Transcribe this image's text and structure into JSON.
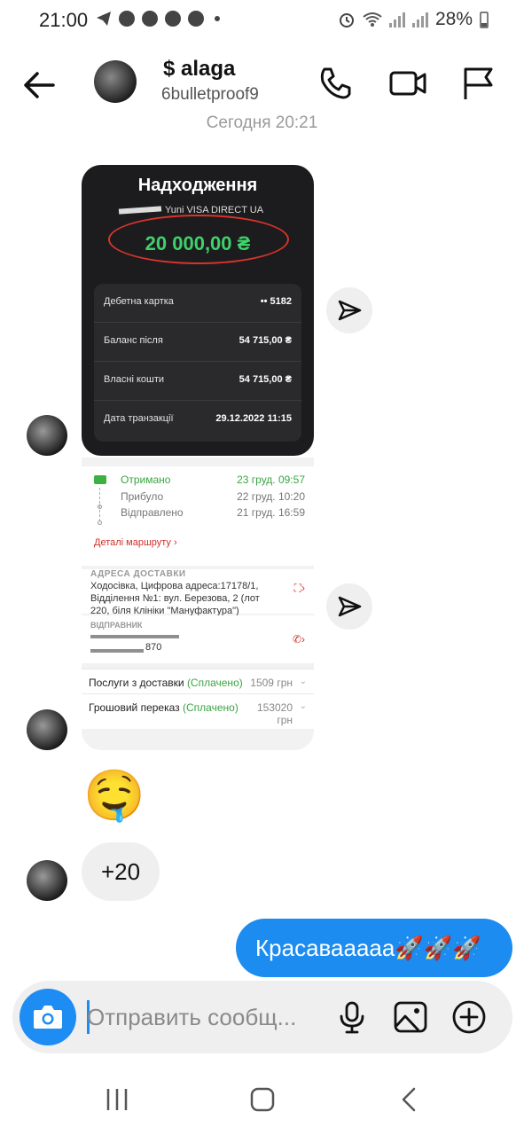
{
  "status_bar": {
    "time": "21:00",
    "battery": "28%"
  },
  "header": {
    "display_name": "$ alaga",
    "username": "6bulletproof9"
  },
  "date_separator": "Сегодня 20:21",
  "receipt_card": {
    "title": "Надходження",
    "subtitle": "Yuni VISA DIRECT UA",
    "amount": "20 000,00 ₴",
    "rows": [
      {
        "label": "Дебетна картка",
        "value": "•• 5182"
      },
      {
        "label": "Баланс після",
        "value": "54 715,00 ₴"
      },
      {
        "label": "Власні кошти",
        "value": "54 715,00 ₴"
      },
      {
        "label": "Дата транзакції",
        "value": "29.12.2022 11:15"
      }
    ]
  },
  "delivery_card": {
    "tracking": [
      {
        "label": "Отримано",
        "value": "23 груд. 09:57"
      },
      {
        "label": "Прибуло",
        "value": "22 груд. 10:20"
      },
      {
        "label": "Відправлено",
        "value": "21 груд. 16:59"
      }
    ],
    "route_link": "Деталі маршруту ›",
    "address_header": "АДРЕСА ДОСТАВКИ",
    "address_text": "Ходосівка, Цифрова адреса:17178/1, Відділення №1: вул. Березова, 2 (лот 220, біля Клініки \"Мануфактура\")",
    "sender_header": "ВІДПРАВНИК",
    "sender_phone_tail": "870",
    "fees": [
      {
        "label": "Послуги з доставки",
        "status": "(Сплачено)",
        "value": "1509 грн"
      },
      {
        "label": "Грошовий переказ",
        "status": "(Сплачено)",
        "value": "153020 грн"
      }
    ]
  },
  "messages": {
    "emoji": "🤤",
    "incoming_text": "+20",
    "outgoing_text": "Красавааааа🚀🚀🚀"
  },
  "composer": {
    "placeholder": "Отправить сообщ..."
  },
  "icons": {
    "back": "arrow-left-icon",
    "call": "phone-icon",
    "video": "video-camera-icon",
    "report": "flag-icon",
    "share": "send-icon",
    "camera": "camera-icon",
    "mic": "microphone-icon",
    "gallery": "image-icon",
    "add": "plus-circle-icon"
  },
  "colors": {
    "outgoing_bubble": "#1c8cf1",
    "amount_green": "#3fd16a",
    "highlight_oval": "#d8342c"
  }
}
